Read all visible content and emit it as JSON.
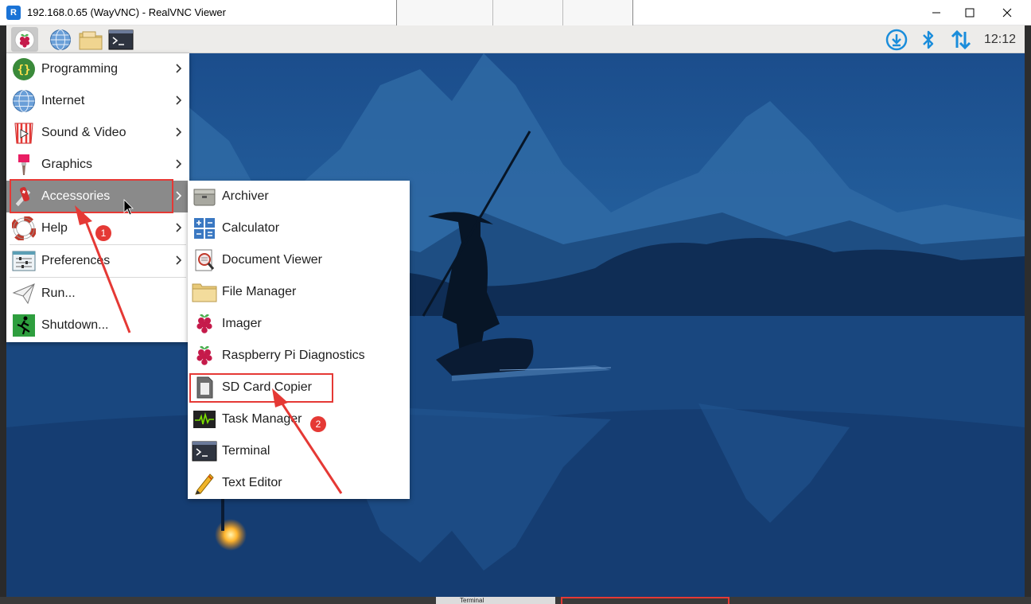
{
  "window": {
    "title": "192.168.0.65 (WayVNC) - RealVNC Viewer",
    "app_icon_glyph": "R",
    "controls": [
      "minimize-icon",
      "maximize-icon",
      "close-icon"
    ]
  },
  "panel": {
    "launchers": [
      "raspberry-menu-icon",
      "web-browser-icon",
      "file-manager-icon",
      "terminal-icon"
    ],
    "tray": [
      "download-updates-icon",
      "bluetooth-icon",
      "network-icon"
    ],
    "clock": "12:12",
    "accent": "#1a8ddb"
  },
  "main_menu": {
    "items": [
      {
        "label": "Programming",
        "icon": "programming-icon",
        "submenu": true
      },
      {
        "label": "Internet",
        "icon": "internet-icon",
        "submenu": true
      },
      {
        "label": "Sound & Video",
        "icon": "sound-video-icon",
        "submenu": true
      },
      {
        "label": "Graphics",
        "icon": "graphics-icon",
        "submenu": true
      },
      {
        "label": "Accessories",
        "icon": "accessories-icon",
        "submenu": true,
        "selected": true
      },
      {
        "label": "Help",
        "icon": "help-icon",
        "submenu": true
      },
      {
        "label": "Preferences",
        "icon": "preferences-icon",
        "submenu": true
      },
      {
        "label": "Run...",
        "icon": "run-icon",
        "submenu": false
      },
      {
        "label": "Shutdown...",
        "icon": "shutdown-icon",
        "submenu": false
      }
    ]
  },
  "accessories_menu": {
    "items": [
      {
        "label": "Archiver",
        "icon": "archiver-icon"
      },
      {
        "label": "Calculator",
        "icon": "calculator-icon"
      },
      {
        "label": "Document Viewer",
        "icon": "document-viewer-icon"
      },
      {
        "label": "File Manager",
        "icon": "folder-icon"
      },
      {
        "label": "Imager",
        "icon": "raspberry-icon"
      },
      {
        "label": "Raspberry Pi Diagnostics",
        "icon": "raspberry-icon"
      },
      {
        "label": "SD Card Copier",
        "icon": "sd-card-icon"
      },
      {
        "label": "Task Manager",
        "icon": "task-manager-icon"
      },
      {
        "label": "Terminal",
        "icon": "terminal-icon"
      },
      {
        "label": "Text Editor",
        "icon": "text-editor-icon"
      }
    ]
  },
  "annotations": {
    "step1": "1",
    "step2": "2",
    "color": "#e53935"
  },
  "taskbar": {
    "terminal_tab": "Terminal"
  }
}
